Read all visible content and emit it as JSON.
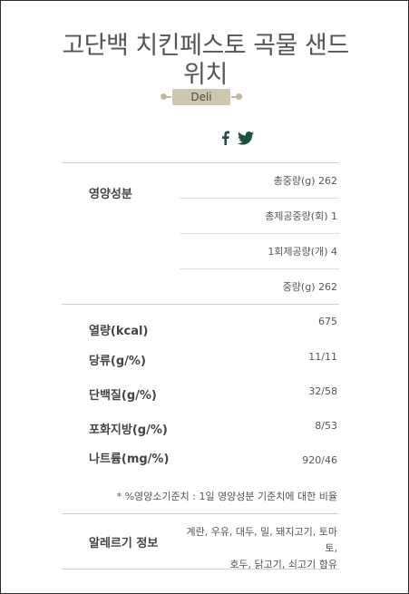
{
  "product": {
    "title_line1": "고단백 치킨페스토 곡물 샌드",
    "title_line2": "위치",
    "category_tag": "Deli"
  },
  "share": {
    "facebook_icon": "facebook-icon",
    "twitter_icon": "twitter-icon",
    "icon_color": "#1f4f45"
  },
  "nutrition": {
    "section_label": "영양성분",
    "serving_rows": [
      "총중량(g) 262",
      "총제공중량(회) 1",
      "1회제공량(개) 4",
      "중량(g) 262"
    ],
    "facts": [
      {
        "label": "열량(kcal)",
        "value": "675"
      },
      {
        "label": "당류(g/%)",
        "value": "11/11"
      },
      {
        "label": "단백질(g/%)",
        "value": "32/58"
      },
      {
        "label": "포화지방(g/%)",
        "value": "8/53"
      },
      {
        "label": "나트륨(mg/%)",
        "value": "920/46"
      }
    ],
    "note": "* %영양소기준치 : 1일 영양성분 기준치에 대한 비율"
  },
  "allergy": {
    "label": "알레르기 정보",
    "line1": "계란, 우유, 대두, 밀, 돼지고기, 토마토,",
    "line2": "호두, 닭고기, 쇠고기 함유"
  }
}
